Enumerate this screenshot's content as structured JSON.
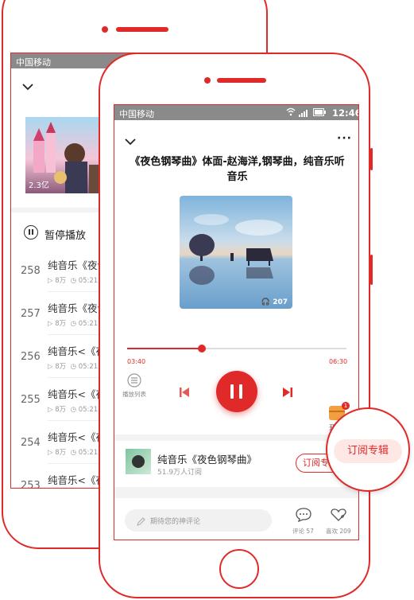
{
  "back_screen": {
    "carrier": "中国移动",
    "album_badge": "2.3亿",
    "pause_label": "暂停播放",
    "tracks": [
      {
        "index": "258",
        "title": "纯音乐《夜色",
        "plays": "8万",
        "duration": "05:21"
      },
      {
        "index": "257",
        "title": "纯音乐《夜色",
        "plays": "8万",
        "duration": "05:21"
      },
      {
        "index": "256",
        "title": "纯音乐<《夜色",
        "plays": "8万",
        "duration": "05:21"
      },
      {
        "index": "255",
        "title": "纯音乐<《夜色",
        "plays": "8万",
        "duration": "05:21"
      },
      {
        "index": "254",
        "title": "纯音乐<《夜色",
        "plays": "8万",
        "duration": "05:21"
      },
      {
        "index": "253",
        "title": "纯音乐<《夜色",
        "plays": "",
        "duration": ""
      }
    ]
  },
  "front_screen": {
    "carrier": "中国移动",
    "time": "12:46",
    "title": "《夜色钢琴曲》体面-赵海洋,钢琴曲，纯音乐听音乐",
    "cover_listen_count": "207",
    "progress": {
      "elapsed": "03:40",
      "total": "06:30",
      "fraction": 0.34
    },
    "playlist_label": "播放列表",
    "vip_label": "开",
    "vip_badge": "1",
    "album": {
      "name": "纯音乐《夜色钢琴曲》",
      "subscribers": "51.9万人订阅",
      "subscribe_label": "订阅专"
    },
    "comment_placeholder": "期待您的神评论",
    "comment_label": "评论 57",
    "like_label": "喜欢 209"
  },
  "callout": {
    "label": "订阅专辑"
  },
  "colors": {
    "accent": "#e02a2a",
    "status_bar": "#8a8a8a"
  }
}
